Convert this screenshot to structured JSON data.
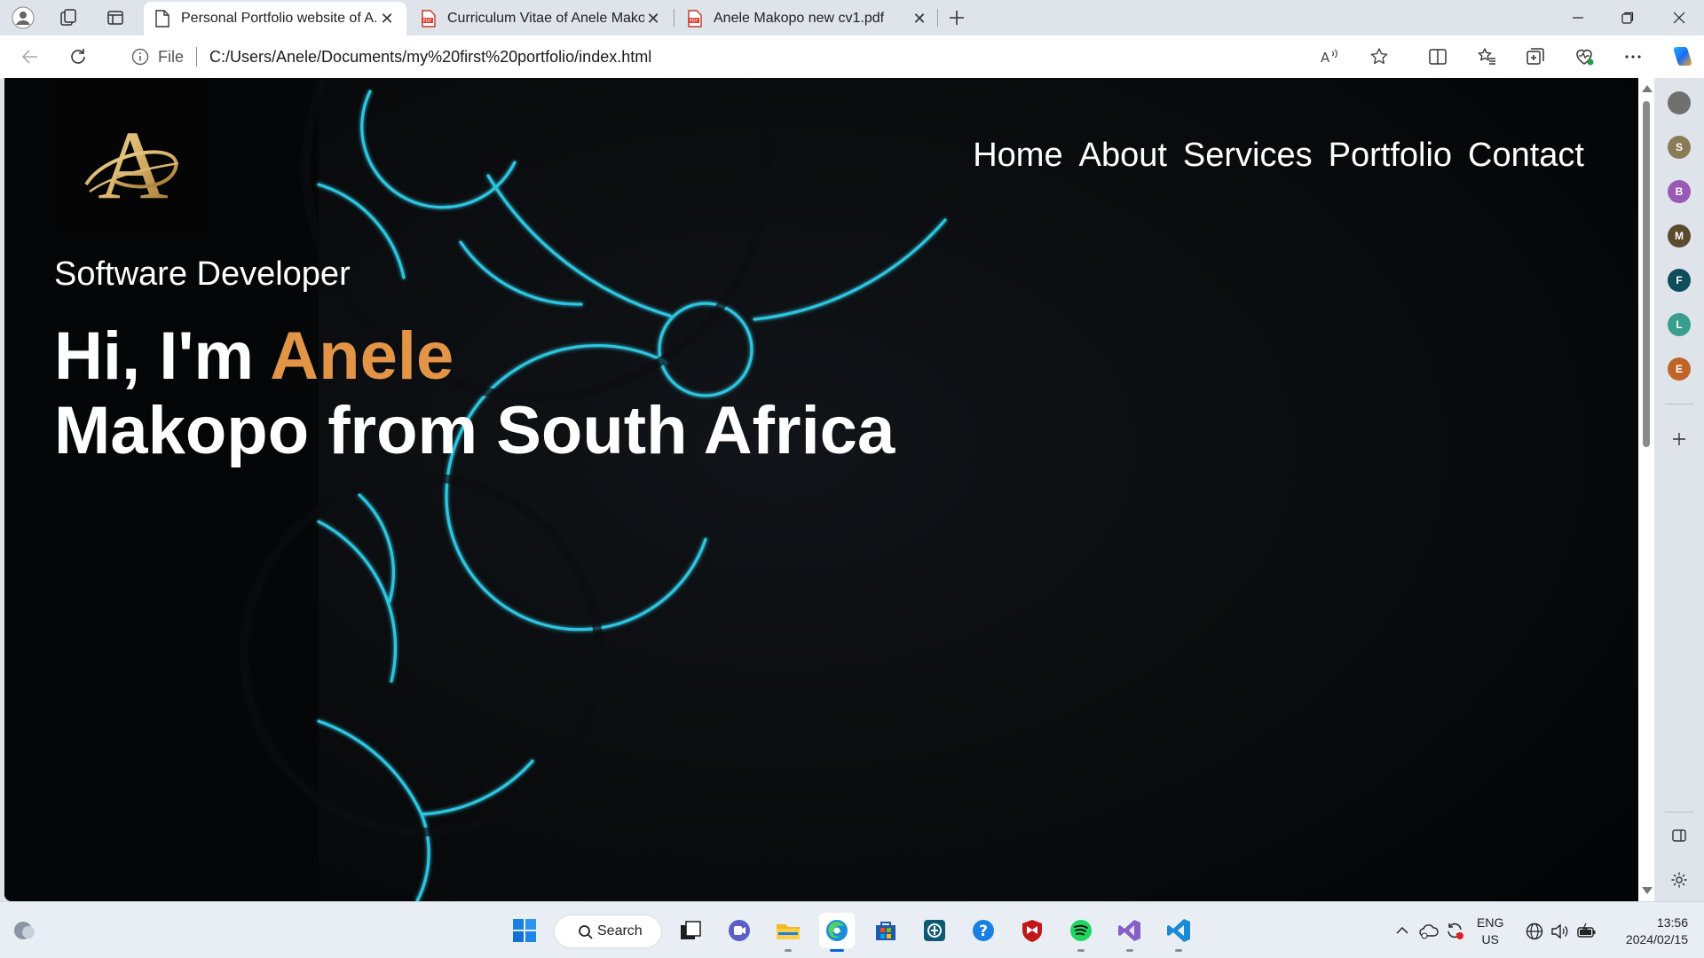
{
  "browser": {
    "tabs": [
      {
        "title": "Personal Portfolio website of A.Makopo",
        "active": true,
        "icon": "page-icon"
      },
      {
        "title": "Curriculum Vitae of Anele Makopo",
        "active": false,
        "icon": "pdf-icon"
      },
      {
        "title": "Anele Makopo new cv1.pdf",
        "active": false,
        "icon": "pdf-icon"
      }
    ],
    "address_scheme": "File",
    "address_url": "C:/Users/Anele/Documents/my%20first%20portfolio/index.html"
  },
  "site": {
    "logo_letter": "A",
    "nav": [
      "Home",
      "About",
      "Services",
      "Portfolio",
      "Contact"
    ],
    "subtitle": "Software Developer",
    "greeting": "Hi, I'm ",
    "name_highlight": "Anele",
    "title_line2": "Makopo from South Africa",
    "colors": {
      "background": "#000000",
      "accent": "#e29447",
      "ring": "#2ec5e0",
      "text": "#ffffff",
      "logo_gold": "#d9b26a"
    }
  },
  "edge_sidebar": {
    "items": [
      {
        "letter": "",
        "color": "#707070"
      },
      {
        "letter": "S",
        "color": "#8a7b57"
      },
      {
        "letter": "B",
        "color": "#9b59b6"
      },
      {
        "letter": "M",
        "color": "#5a4a2e"
      },
      {
        "letter": "F",
        "color": "#0f4c5c"
      },
      {
        "letter": "L",
        "color": "#3a9e8f"
      },
      {
        "letter": "E",
        "color": "#c0652a"
      }
    ]
  },
  "taskbar": {
    "search_label": "Search",
    "lang_line1": "ENG",
    "lang_line2": "US",
    "time": "13:56",
    "date": "2024/02/15",
    "apps": [
      "start-icon",
      "search",
      "task-view-icon",
      "teams-icon",
      "file-explorer-icon",
      "edge-icon",
      "store-icon",
      "app-icon",
      "help-icon",
      "mcafee-icon",
      "spotify-icon",
      "visual-studio-icon",
      "vscode-icon"
    ]
  }
}
